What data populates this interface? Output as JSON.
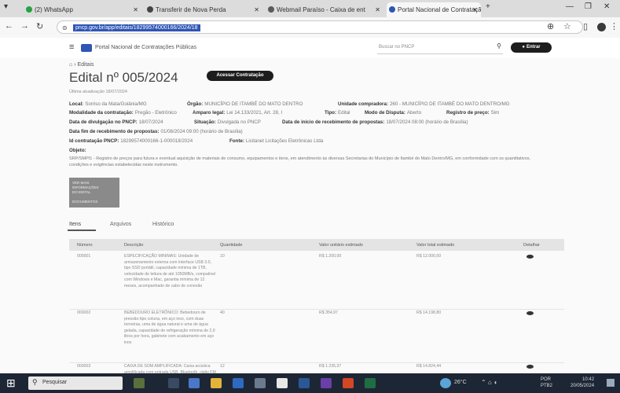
{
  "browser": {
    "tabs": [
      {
        "label": "(2) WhatsApp",
        "active": false
      },
      {
        "label": "Transferir de Nova Perda",
        "active": false
      },
      {
        "label": "Webmail Paraíso - Caixa de ent",
        "active": false
      },
      {
        "label": "Portal Nacional de Contratação",
        "active": true
      }
    ],
    "new_tab": "+",
    "url": "pncp.gov.br/app/editais/18299574000166/2024/18"
  },
  "site": {
    "title": "Portal Nacional de Contratações Públicas",
    "search_placeholder": "Buscar no PNCP",
    "login_label": "Entrar"
  },
  "breadcrumb": {
    "home": "⌂",
    "sep": "›",
    "current": "Editais"
  },
  "edital": {
    "title": "Edital nº 005/2024",
    "action_button": "Acessar Contratação",
    "updated": "Última atualização 18/07/2024",
    "fields": [
      {
        "label": "Local:",
        "value": "Sorriso da Mata/Goiânia/MG"
      },
      {
        "label": "Órgão:",
        "value": "MUNICÍPIO DE ITAMBÉ DO MATO DENTRO"
      },
      {
        "label": "Unidade compradora:",
        "value": "260 - MUNICÍPIO DE ITAMBÉ DO MATO DENTRO/MG"
      },
      {
        "label": "Modalidade da contratação:",
        "value": "Pregão - Eletrônico"
      },
      {
        "label": "Amparo legal:",
        "value": "Lei 14.133/2021, Art. 28, I"
      },
      {
        "label": "Tipo:",
        "value": "Edital"
      },
      {
        "label": "Modo de Disputa:",
        "value": "Aberto"
      },
      {
        "label": "Registro de preço:",
        "value": "Sim"
      },
      {
        "label": "Data de divulgação no PNCP:",
        "value": "18/07/2024"
      },
      {
        "label": "Situação:",
        "value": "Divulgada no PNCP"
      },
      {
        "label": "Data de início de recebimento de propostas:",
        "value": "18/07/2024 08:00 (horário de Brasília)"
      },
      {
        "label": "Data fim de recebimento de propostas:",
        "value": "01/08/2024 09:00 (horário de Brasília)"
      },
      {
        "label": "Id contratação PNCP:",
        "value": "18299574000166-1-000018/2024"
      },
      {
        "label": "Fonte:",
        "value": "Licitanet Licitações Eletrônicas Ltda"
      }
    ],
    "object_label": "Objeto:",
    "object_text": "SRP/SMPI1 - Registro de preços para futura e eventual aquisição de materiais de consumo, equipamentos e itens, em atendimento às diversas Secretarias do Município de Itambé do Mato Dentro/MG, em conformidade com os quantitativos, condições e exigências estabelecidas neste instrumento.",
    "docs_box": [
      "VER MAIS INFORMAÇÕES",
      "DO EDITAL",
      "",
      "DOCUMENTOS"
    ]
  },
  "tabs": {
    "items": "Itens",
    "files": "Arquivos",
    "history": "Histórico"
  },
  "table": {
    "headers": [
      "Número",
      "Descrição",
      "Quantidade",
      "Valor unitário estimado",
      "Valor total estimado",
      "Detalhar"
    ],
    "rows": [
      {
        "number": "000001",
        "description": "ESPECIFICAÇÃO MINIMAS: Unidade de armazenamento externa com interface USB 3.0, tipo SSD portátil, capacidade mínima de 1TB, velocidade de leitura de até 1050MB/s, compatível com Windows e Mac, garantia mínima de 12 meses, acompanhado de cabo de conexão",
        "quantity": "10",
        "unit": "R$ 1.200,00",
        "total": "R$ 12.000,00"
      },
      {
        "number": "000002",
        "description": "BEBEDOURO ELETRÔNICO: Bebedouro de pressão tipo coluna, em aço inox, com duas torneiras, uma de água natural e uma de água gelada, capacidade de refrigeração mínima de 2,0 litros por hora, gabinete com acabamento em aço inox",
        "quantity": "40",
        "unit": "R$ 354,97",
        "total": "R$ 14.198,80"
      },
      {
        "number": "000003",
        "description": "CAIXA DE SOM AMPLIFICADA: Caixa acústica amplificada com entrada USB, Bluetooth, rádio FM e microfone sem fio",
        "quantity": "12",
        "unit": "R$ 1.235,37",
        "total": "R$ 14.824,44"
      }
    ]
  },
  "taskbar": {
    "search_placeholder": "Pesquisar",
    "weather": "26°C",
    "lang1": "POR",
    "lang2": "PTB2",
    "time": "10:42",
    "date": "20/05/2024"
  },
  "colors": {
    "dark": "#1d1d1d",
    "primary": "#2f55b5",
    "taskbar": "#1d2635"
  }
}
